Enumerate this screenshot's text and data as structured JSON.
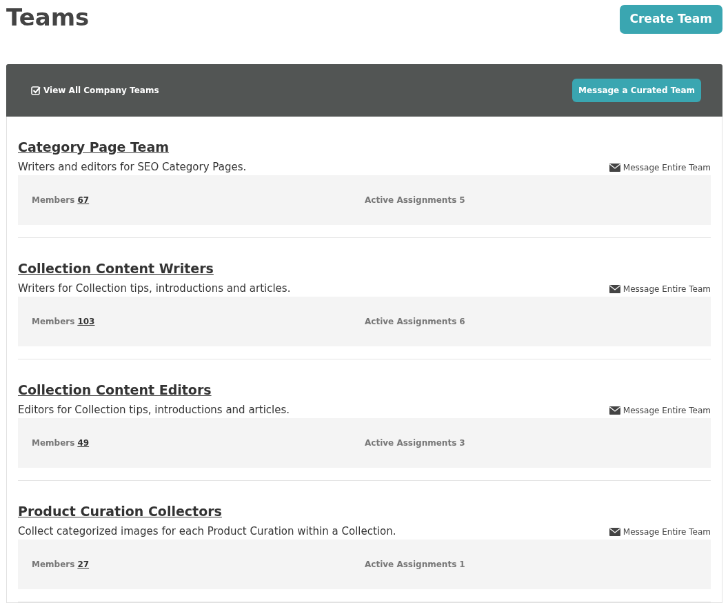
{
  "page_title": "Teams",
  "create_button": "Create Team",
  "toolbar": {
    "view_all": {
      "label": "View All Company Teams",
      "checked": true
    },
    "message_button": "Message a Curated Team"
  },
  "teams": [
    {
      "name": "Category Page Team",
      "description": "Writers and editors for SEO Category Pages.",
      "message_link": "Message Entire Team",
      "members_label": "Members",
      "members": "67",
      "assignments_label": "Active Assignments",
      "assignments": "5"
    },
    {
      "name": "Collection Content Writers",
      "description": "Writers for Collection tips, introductions and articles.",
      "message_link": "Message Entire Team",
      "members_label": "Members",
      "members": "103",
      "assignments_label": "Active Assignments",
      "assignments": "6"
    },
    {
      "name": "Collection Content Editors",
      "description": "Editors for Collection tips, introductions and articles.",
      "message_link": "Message Entire Team",
      "members_label": "Members",
      "members": "49",
      "assignments_label": "Active Assignments",
      "assignments": "3"
    },
    {
      "name": "Product Curation Collectors",
      "description": "Collect categorized images for each Product Curation within a Collection.",
      "message_link": "Message Entire Team",
      "members_label": "Members",
      "members": "27",
      "assignments_label": "Active Assignments",
      "assignments": "1"
    }
  ]
}
